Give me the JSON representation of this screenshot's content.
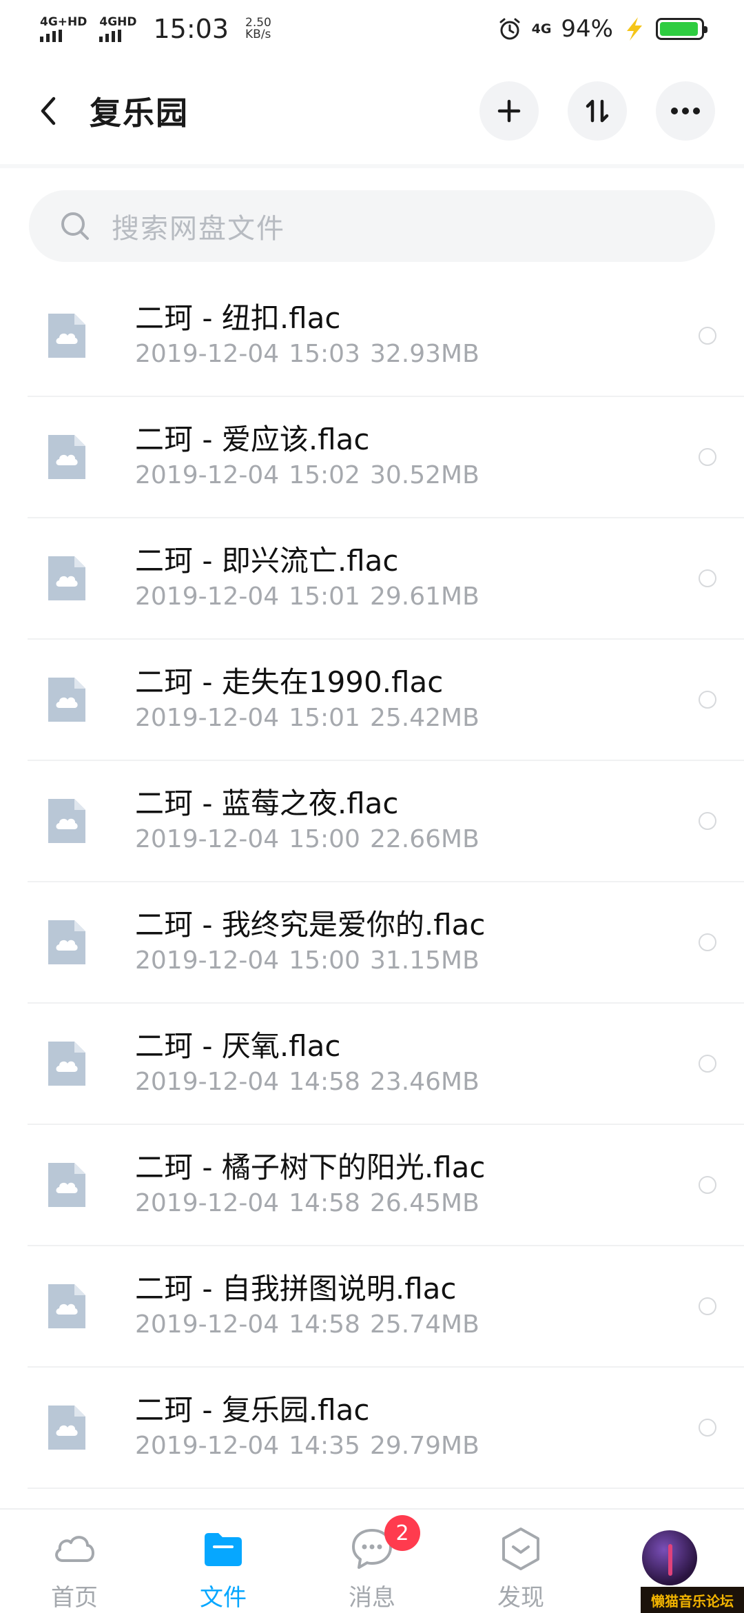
{
  "status_bar": {
    "signal1_label": "4G+HD",
    "signal2_label": "4GHD",
    "time": "15:03",
    "speed_value": "2.50",
    "speed_unit": "KB/s",
    "network": "4G",
    "battery_pct": "94%",
    "battery_level": 0.94,
    "icons": [
      "alarm-icon",
      "lightning-icon",
      "battery-icon"
    ]
  },
  "header": {
    "title": "复乐园",
    "actions": [
      "add-icon",
      "sort-icon",
      "more-icon"
    ]
  },
  "search": {
    "placeholder": "搜索网盘文件"
  },
  "files": [
    {
      "name": "二珂 - 纽扣.flac",
      "date": "2019-12-04",
      "time": "15:03",
      "size": "32.93MB"
    },
    {
      "name": "二珂 - 爱应该.flac",
      "date": "2019-12-04",
      "time": "15:02",
      "size": "30.52MB"
    },
    {
      "name": "二珂 - 即兴流亡.flac",
      "date": "2019-12-04",
      "time": "15:01",
      "size": "29.61MB"
    },
    {
      "name": "二珂 - 走失在1990.flac",
      "date": "2019-12-04",
      "time": "15:01",
      "size": "25.42MB"
    },
    {
      "name": "二珂 - 蓝莓之夜.flac",
      "date": "2019-12-04",
      "time": "15:00",
      "size": "22.66MB"
    },
    {
      "name": "二珂 - 我终究是爱你的.flac",
      "date": "2019-12-04",
      "time": "15:00",
      "size": "31.15MB"
    },
    {
      "name": "二珂 - 厌氧.flac",
      "date": "2019-12-04",
      "time": "14:58",
      "size": "23.46MB"
    },
    {
      "name": "二珂 - 橘子树下的阳光.flac",
      "date": "2019-12-04",
      "time": "14:58",
      "size": "26.45MB"
    },
    {
      "name": "二珂 - 自我拼图说明.flac",
      "date": "2019-12-04",
      "time": "14:58",
      "size": "25.74MB"
    },
    {
      "name": "二珂 - 复乐园.flac",
      "date": "2019-12-04",
      "time": "14:35",
      "size": "29.79MB"
    }
  ],
  "nav": {
    "home": "首页",
    "files": "文件",
    "messages": "消息",
    "messages_badge": "2",
    "discover": "发现"
  },
  "watermark": "懒猫音乐论坛",
  "colors": {
    "accent": "#06a7ff",
    "badge": "#ff3b4e",
    "file_icon": "#b9c7d6",
    "battery": "#2ecc40"
  }
}
